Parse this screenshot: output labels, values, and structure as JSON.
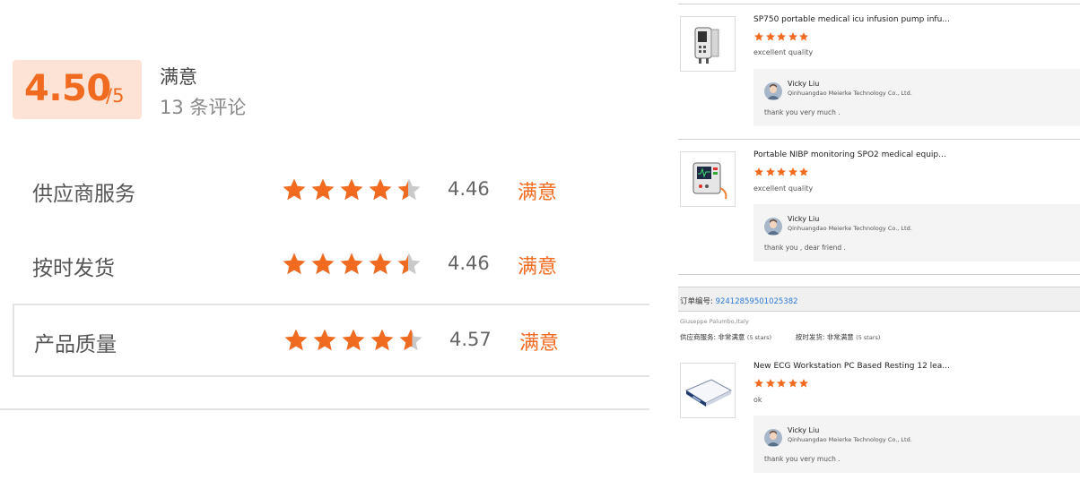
{
  "summary": {
    "score": "4.50",
    "score_max": "/5",
    "satisfaction": "满意",
    "review_count": "13 条评论"
  },
  "ratings": [
    {
      "name": "供应商服务",
      "stars": 4.46,
      "value": "4.46",
      "satisfaction": "满意"
    },
    {
      "name": "按时发货",
      "stars": 4.46,
      "value": "4.46",
      "satisfaction": "满意"
    },
    {
      "name": "产品质量",
      "stars": 4.57,
      "value": "4.57",
      "satisfaction": "满意"
    }
  ],
  "reviews": [
    {
      "product_title": "SP750 portable medical icu infusion pump infu...",
      "product_icon": "infusion-pump-icon",
      "stars": 5,
      "comment": "excellent quality",
      "reply": {
        "seller_name": "Vicky Liu",
        "company": "Qinhuangdao Meierke Technology Co., Ltd.",
        "text": "thank you very much ."
      }
    },
    {
      "product_title": "Portable NIBP monitoring SPO2 medical equip...",
      "product_icon": "patient-monitor-icon",
      "stars": 5,
      "comment": "excellent quality",
      "reply": {
        "seller_name": "Vicky Liu",
        "company": "Qinhuangdao Meierke Technology Co., Ltd.",
        "text": "thank you , dear friend ."
      }
    },
    {
      "product_title": "New ECG Workstation PC Based Resting 12 lea...",
      "product_icon": "ecg-workstation-icon",
      "stars": 5,
      "comment": "ok",
      "reply": {
        "seller_name": "Vicky Liu",
        "company": "Qinhuangdao Meierke Technology Co., Ltd.",
        "text": "thank you very much ."
      }
    }
  ],
  "order": {
    "label": "订单编号:",
    "number": "92412859501025382",
    "buyer": "Giuseppe Palumbo,Italy",
    "supplier_service": "供应商服务: 非常满意",
    "supplier_service_stars": "(5 stars)",
    "on_time_delivery": "按时发货: 非常满意",
    "on_time_delivery_stars": "(5 stars)"
  },
  "colors": {
    "accent": "#f06a1f",
    "score_bg": "#fde3d6",
    "star_empty": "#c9c9c9",
    "link": "#2b7bd6"
  }
}
